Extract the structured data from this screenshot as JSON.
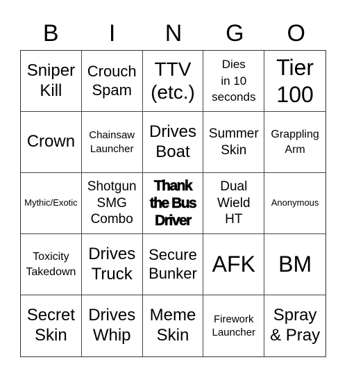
{
  "header": {
    "letters": [
      "B",
      "I",
      "N",
      "G",
      "O"
    ]
  },
  "card": {
    "rows": [
      [
        "Sniper\nKill",
        "Crouch\nSpam",
        "TTV\n(etc.)",
        "Dies\nin 10\nseconds",
        "Tier\n100"
      ],
      [
        "Crown",
        "Chainsaw\nLauncher",
        "Drives\nBoat",
        "Summer\nSkin",
        "Grappling\nArm"
      ],
      [
        "Mythic/Exotic",
        "Shotgun\nSMG\nCombo",
        "Thank\nthe Bus\nDriver",
        "Dual\nWield\nHT",
        "Anonymous"
      ],
      [
        "Toxicity\nTakedown",
        "Drives\nTruck",
        "Secure\nBunker",
        "AFK",
        "BM"
      ],
      [
        "Secret\nSkin",
        "Drives\nWhip",
        "Meme\nSkin",
        "Firework\nLauncher",
        "Spray\n& Pray"
      ]
    ],
    "free_space": "Thank\nthe Bus\nDriver"
  }
}
